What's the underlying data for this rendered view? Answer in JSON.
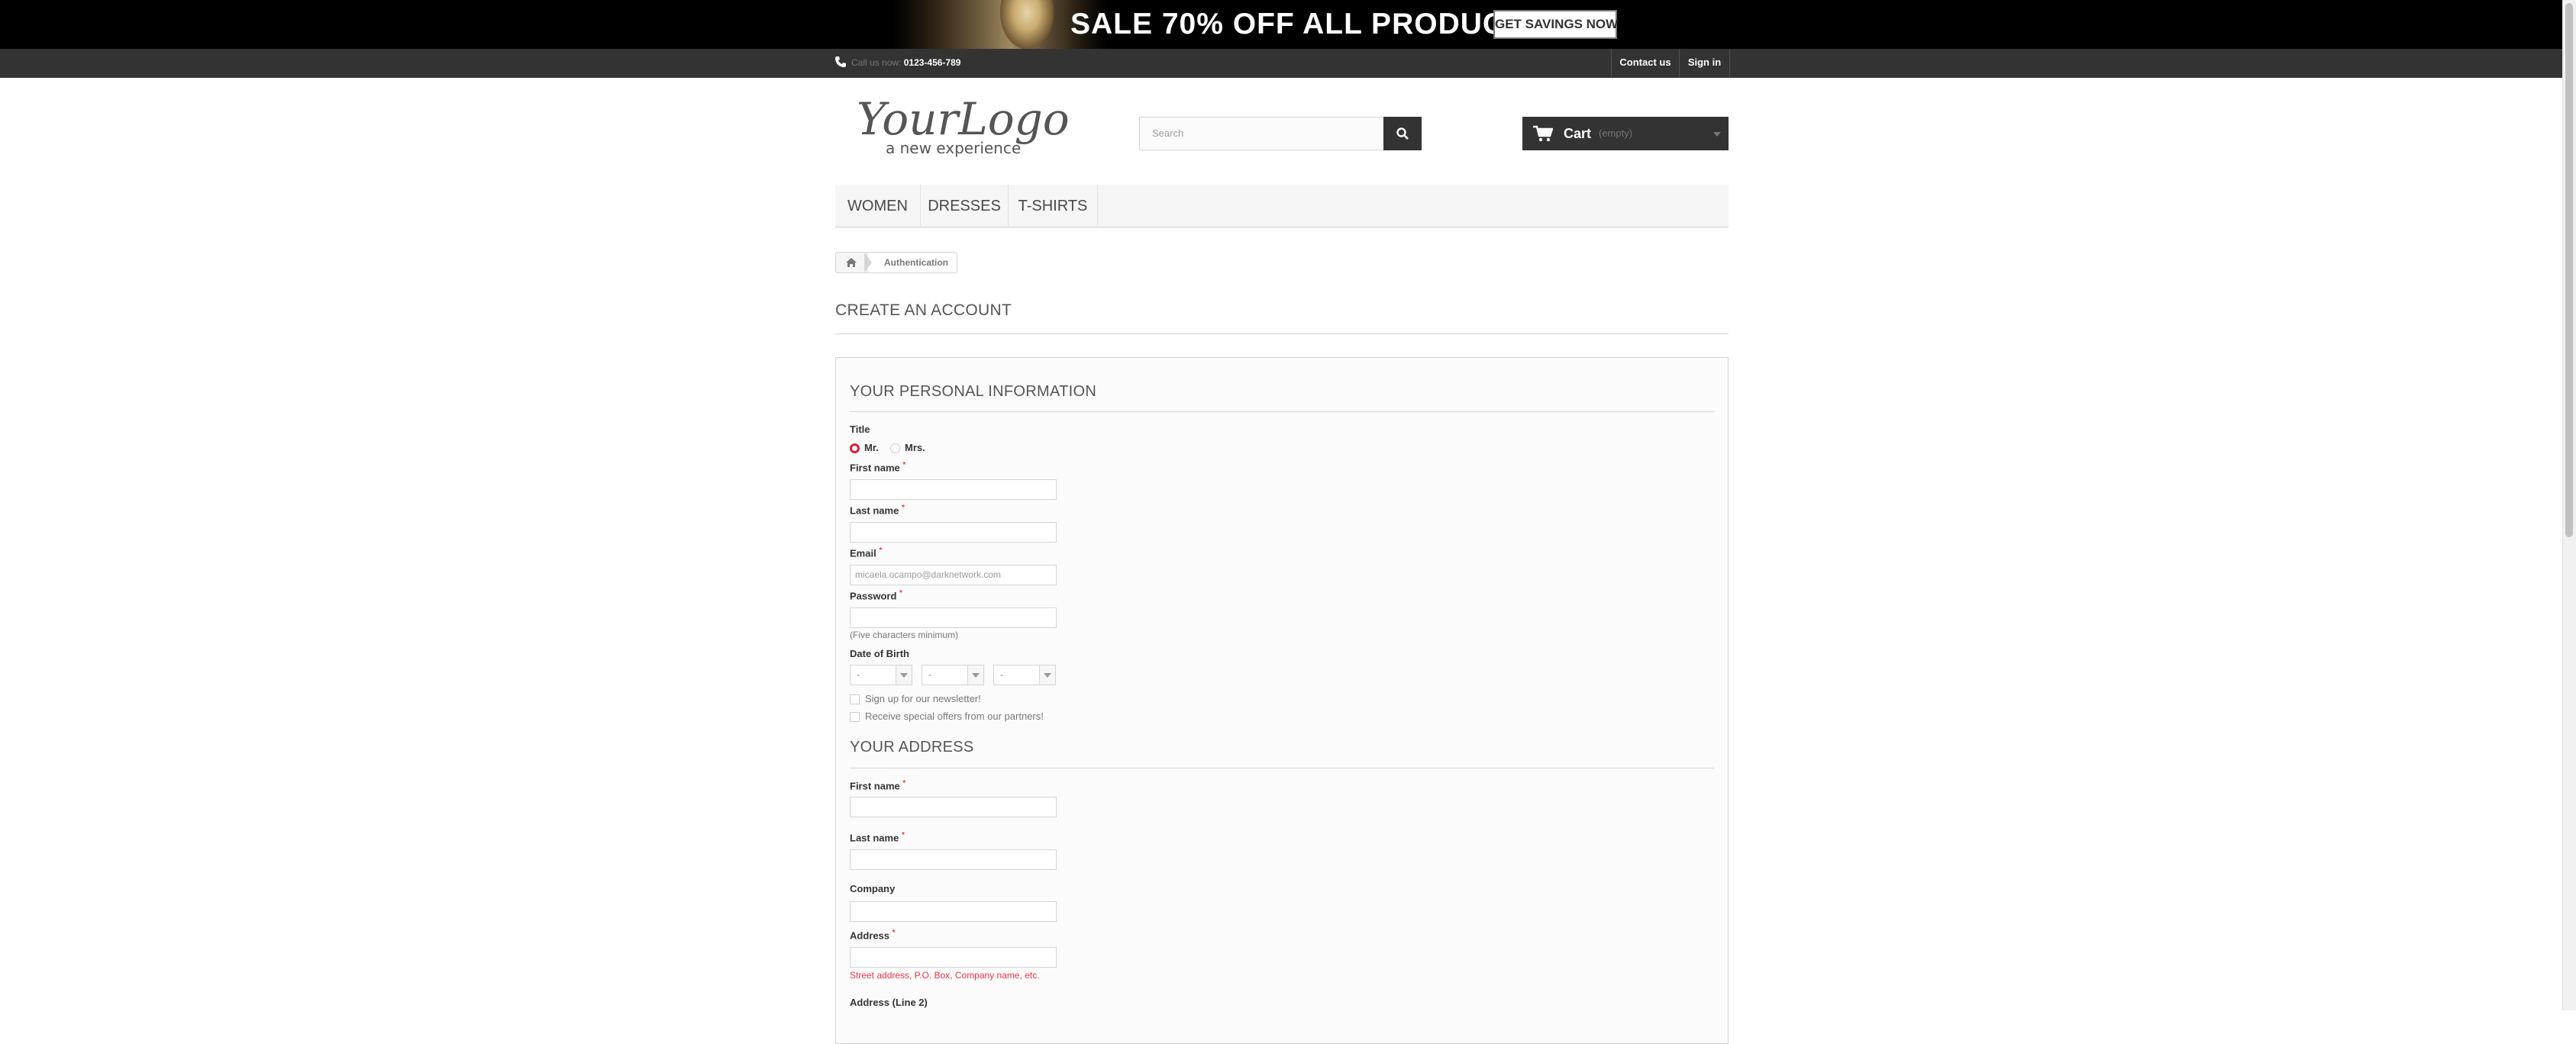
{
  "promo": {
    "text": "SALE 70% OFF ALL PRODUCTS",
    "button": "GET SAVINGS NOW"
  },
  "topnav": {
    "call_label": "Call us now:",
    "phone": "0123-456-789",
    "contact": "Contact us",
    "signin": "Sign in"
  },
  "header": {
    "logo_main": "YourLogo",
    "logo_tagline": "a new experience",
    "search_placeholder": "Search",
    "cart_label": "Cart",
    "cart_status": "(empty)"
  },
  "menu": [
    "WOMEN",
    "DRESSES",
    "T-SHIRTS"
  ],
  "breadcrumb": {
    "current": "Authentication"
  },
  "page": {
    "title": "CREATE AN ACCOUNT",
    "personal": {
      "title": "YOUR PERSONAL INFORMATION",
      "title_label": "Title",
      "mr": "Mr.",
      "mrs": "Mrs.",
      "first_name": "First name",
      "last_name": "Last name",
      "email": "Email",
      "email_value": "micaela.ocampo@darknetwork.com",
      "password": "Password",
      "password_hint": "(Five characters minimum)",
      "dob": "Date of Birth",
      "dob_day": "-",
      "dob_month": "-",
      "dob_year": "-",
      "newsletter": "Sign up for our newsletter!",
      "offers": "Receive special offers from our partners!"
    },
    "address": {
      "title": "YOUR ADDRESS",
      "first_name": "First name",
      "last_name": "Last name",
      "company": "Company",
      "address": "Address",
      "address_hint": "Street address, P.O. Box, Company name, etc.",
      "address2": "Address (Line 2)"
    },
    "required_mark": "*"
  },
  "colors": {
    "accent_red": "#f13340",
    "dark": "#333333"
  }
}
